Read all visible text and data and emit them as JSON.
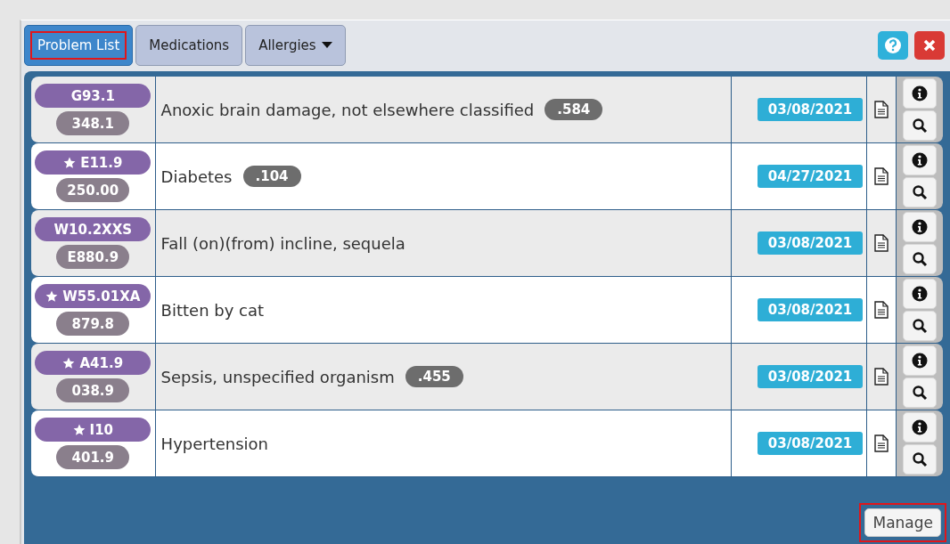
{
  "tabs": [
    {
      "label": "Problem List",
      "selected": true,
      "highlighted": true,
      "dropdown": false
    },
    {
      "label": "Medications",
      "selected": false,
      "highlighted": false,
      "dropdown": false
    },
    {
      "label": "Allergies",
      "selected": false,
      "highlighted": false,
      "dropdown": true
    }
  ],
  "problems": [
    {
      "code": "G93.1",
      "starred": false,
      "legacy_code": "348.1",
      "description": "Anoxic brain damage, not elsewhere classified",
      "score": ".584",
      "date": "03/08/2021"
    },
    {
      "code": "E11.9",
      "starred": true,
      "legacy_code": "250.00",
      "description": "Diabetes",
      "score": ".104",
      "date": "04/27/2021"
    },
    {
      "code": "W10.2XXS",
      "starred": false,
      "legacy_code": "E880.9",
      "description": "Fall (on)(from) incline, sequela",
      "date": "03/08/2021"
    },
    {
      "code": "W55.01XA",
      "starred": true,
      "legacy_code": "879.8",
      "description": "Bitten by cat",
      "date": "03/08/2021"
    },
    {
      "code": "A41.9",
      "starred": true,
      "legacy_code": "038.9",
      "description": "Sepsis, unspecified organism",
      "score": ".455",
      "date": "03/08/2021"
    },
    {
      "code": "I10",
      "starred": true,
      "legacy_code": "401.9",
      "description": "Hypertension",
      "date": "03/08/2021"
    }
  ],
  "manage_button": {
    "label": "Manage",
    "highlighted": true
  }
}
